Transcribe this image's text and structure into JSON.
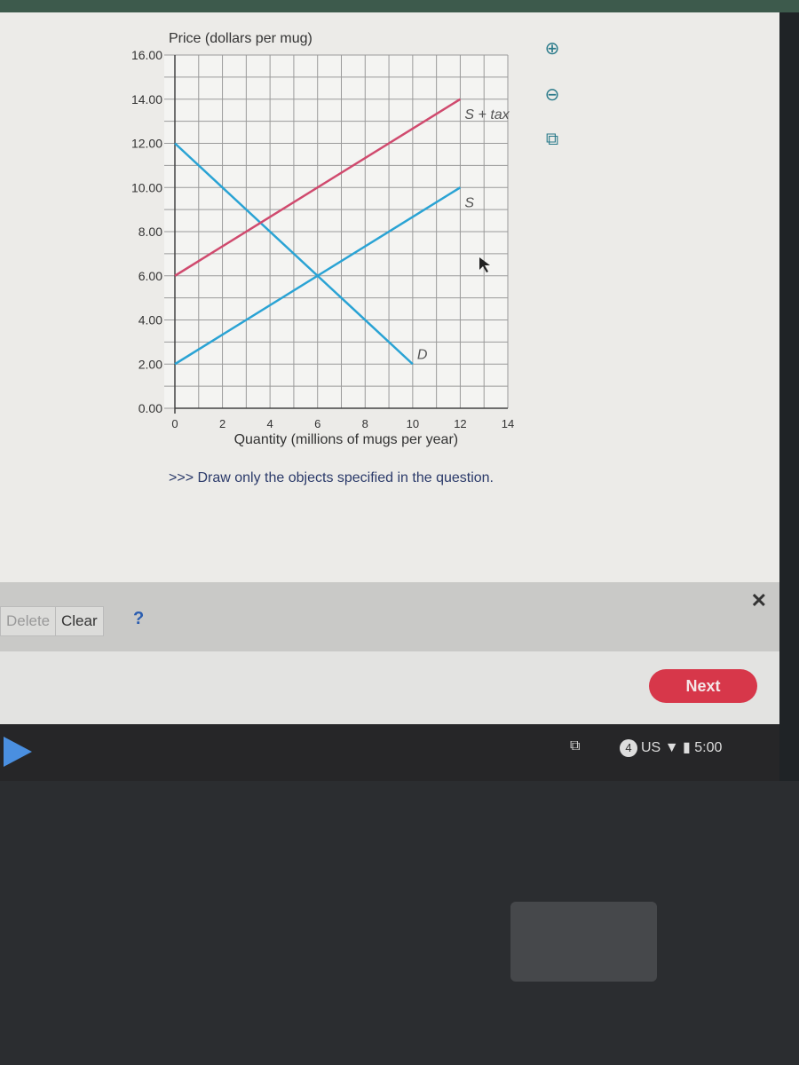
{
  "chart_data": {
    "type": "line",
    "ylabel": "Price (dollars per mug)",
    "xlabel": "Quantity (millions of mugs per year)",
    "xlim": [
      0,
      14
    ],
    "ylim": [
      0,
      16
    ],
    "xticks": [
      "0",
      "2",
      "4",
      "6",
      "8",
      "10",
      "12",
      "14"
    ],
    "yticks": [
      "0.00",
      "2.00",
      "4.00",
      "6.00",
      "8.00",
      "10.00",
      "12.00",
      "14.00",
      "16.00"
    ],
    "grid": true,
    "series": [
      {
        "name": "D",
        "color": "#2aa3d4",
        "x": [
          0,
          10
        ],
        "y": [
          12,
          2
        ]
      },
      {
        "name": "S",
        "color": "#2aa3d4",
        "x": [
          0,
          12
        ],
        "y": [
          2,
          10
        ]
      },
      {
        "name": "S + tax",
        "color": "#d04a6e",
        "x": [
          0,
          12
        ],
        "y": [
          6,
          14
        ]
      }
    ]
  },
  "instruction": ">>> Draw only the objects specified in the question.",
  "toolbar": {
    "delete": "Delete",
    "clear": "Clear",
    "help": "?",
    "close": "✕"
  },
  "footer": {
    "next": "Next"
  },
  "tools": [
    "zoom-in-icon",
    "zoom-out-icon",
    "open-external-icon"
  ],
  "taskbar": {
    "notifications": "4",
    "keyboard": "US",
    "time": "5:00"
  }
}
